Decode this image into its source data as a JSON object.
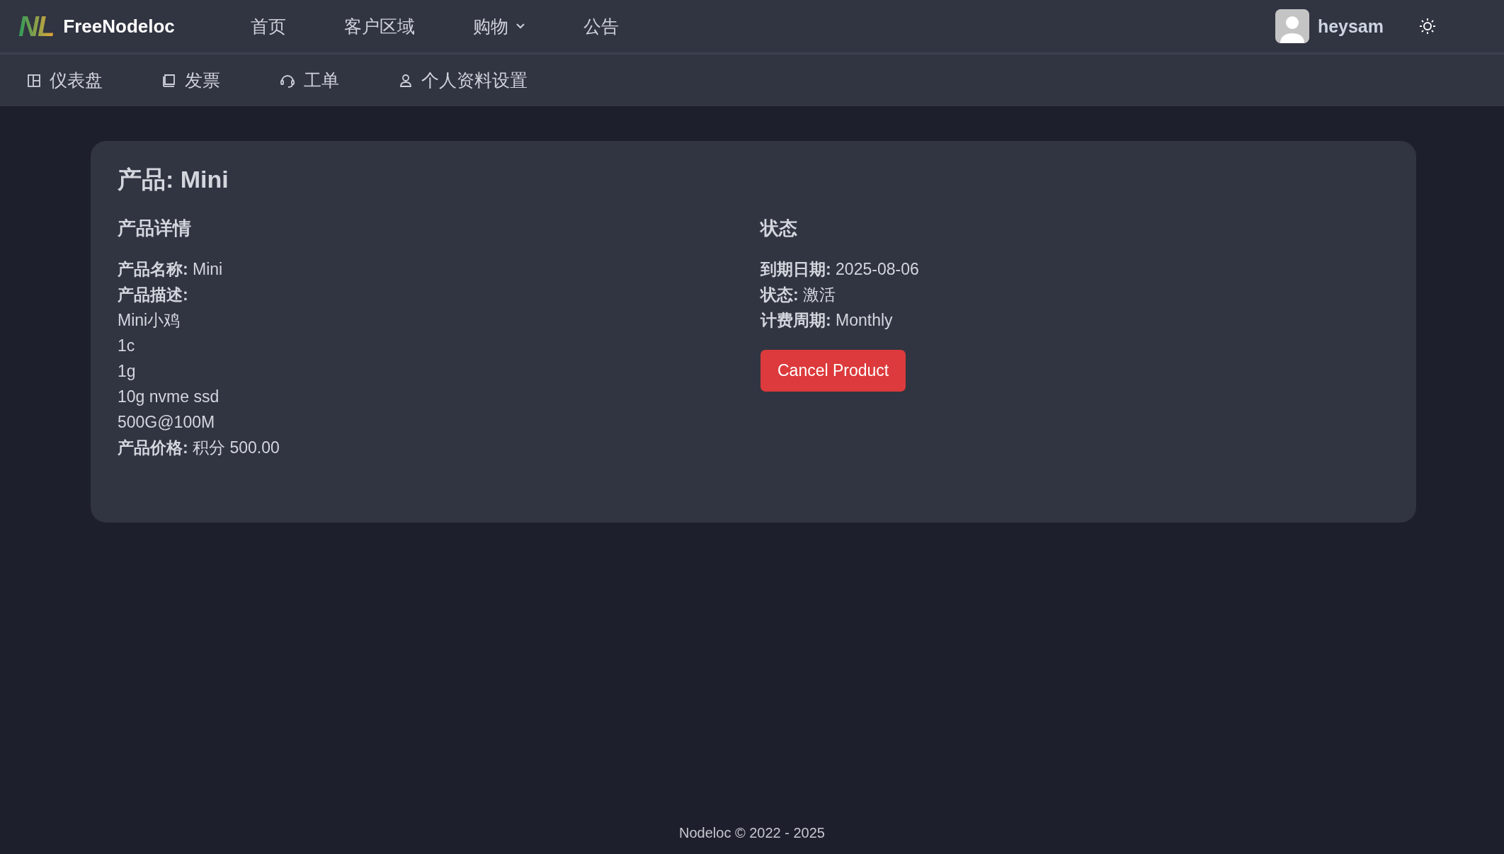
{
  "brand": {
    "logo": "NL",
    "name": "FreeNodeloc"
  },
  "nav": [
    {
      "label": "首页",
      "dropdown": false
    },
    {
      "label": "客户区域",
      "dropdown": false
    },
    {
      "label": "购物",
      "dropdown": true
    },
    {
      "label": "公告",
      "dropdown": false
    }
  ],
  "user": {
    "name": "heysam"
  },
  "subnav": [
    {
      "label": "仪表盘"
    },
    {
      "label": "发票"
    },
    {
      "label": "工单"
    },
    {
      "label": "个人资料设置"
    }
  ],
  "product": {
    "title": "产品: Mini",
    "details": {
      "heading": "产品详情",
      "lines": [
        {
          "kind": "field",
          "label": "产品名称:",
          "value": "Mini"
        },
        {
          "kind": "field",
          "label": "产品描述:"
        },
        {
          "kind": "text",
          "value": "Mini小鸡"
        },
        {
          "kind": "text",
          "value": "1c"
        },
        {
          "kind": "text",
          "value": "1g"
        },
        {
          "kind": "text",
          "value": "10g nvme ssd"
        },
        {
          "kind": "text",
          "value": "500G@100M"
        },
        {
          "kind": "field",
          "label": "产品价格:",
          "value": "积分 500.00"
        }
      ]
    },
    "status": {
      "heading": "状态",
      "lines": [
        {
          "kind": "field",
          "label": "到期日期:",
          "value": "2025-08-06"
        },
        {
          "kind": "field",
          "label": "状态:",
          "value": "激活"
        },
        {
          "kind": "field",
          "label": "计费周期:",
          "value": "Monthly"
        }
      ]
    },
    "cancel_button": "Cancel Product"
  },
  "footer": "Nodeloc © 2022 - 2025"
}
